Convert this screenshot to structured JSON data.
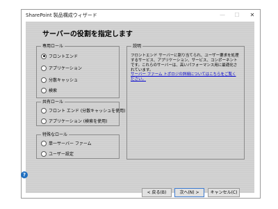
{
  "window": {
    "title": "SharePoint 製品構成ウィザード"
  },
  "page": {
    "heading": "サーバーの役割を指定します"
  },
  "roles": {
    "dedicated": {
      "legend": "専用ロール",
      "options": [
        "フロントエンド",
        "アプリケーション",
        "分散キャッシュ",
        "検索"
      ],
      "selected_index": 0
    },
    "shared": {
      "legend": "共有ロール",
      "options": [
        "フロント エンド (分散キャッシュを使用)",
        "アプリケーション (検索を使用)"
      ]
    },
    "special": {
      "legend": "特殊なロール",
      "options": [
        "単一サーバー ファーム",
        "ユーザー設定"
      ]
    }
  },
  "description": {
    "legend": "説明",
    "text": "フロントエンド サーバーに割り当てられ、ユーザー要求を処理するサービス、アプリケーション、サービス、コンポーネントです。これらのサーバーは、高いパフォーマンス用に最適化されています。",
    "link": "サーバー ファーム トポロジの詳細についてはこちらをご覧ください。"
  },
  "buttons": {
    "back": "< 戻る(B)",
    "next": "次へ(N) >",
    "cancel": "キャンセル(C)"
  },
  "icons": {
    "help": "?"
  },
  "colors": {
    "accent": "#3d7bd1",
    "link": "#0000cc",
    "panel": "#cfcfcf"
  }
}
